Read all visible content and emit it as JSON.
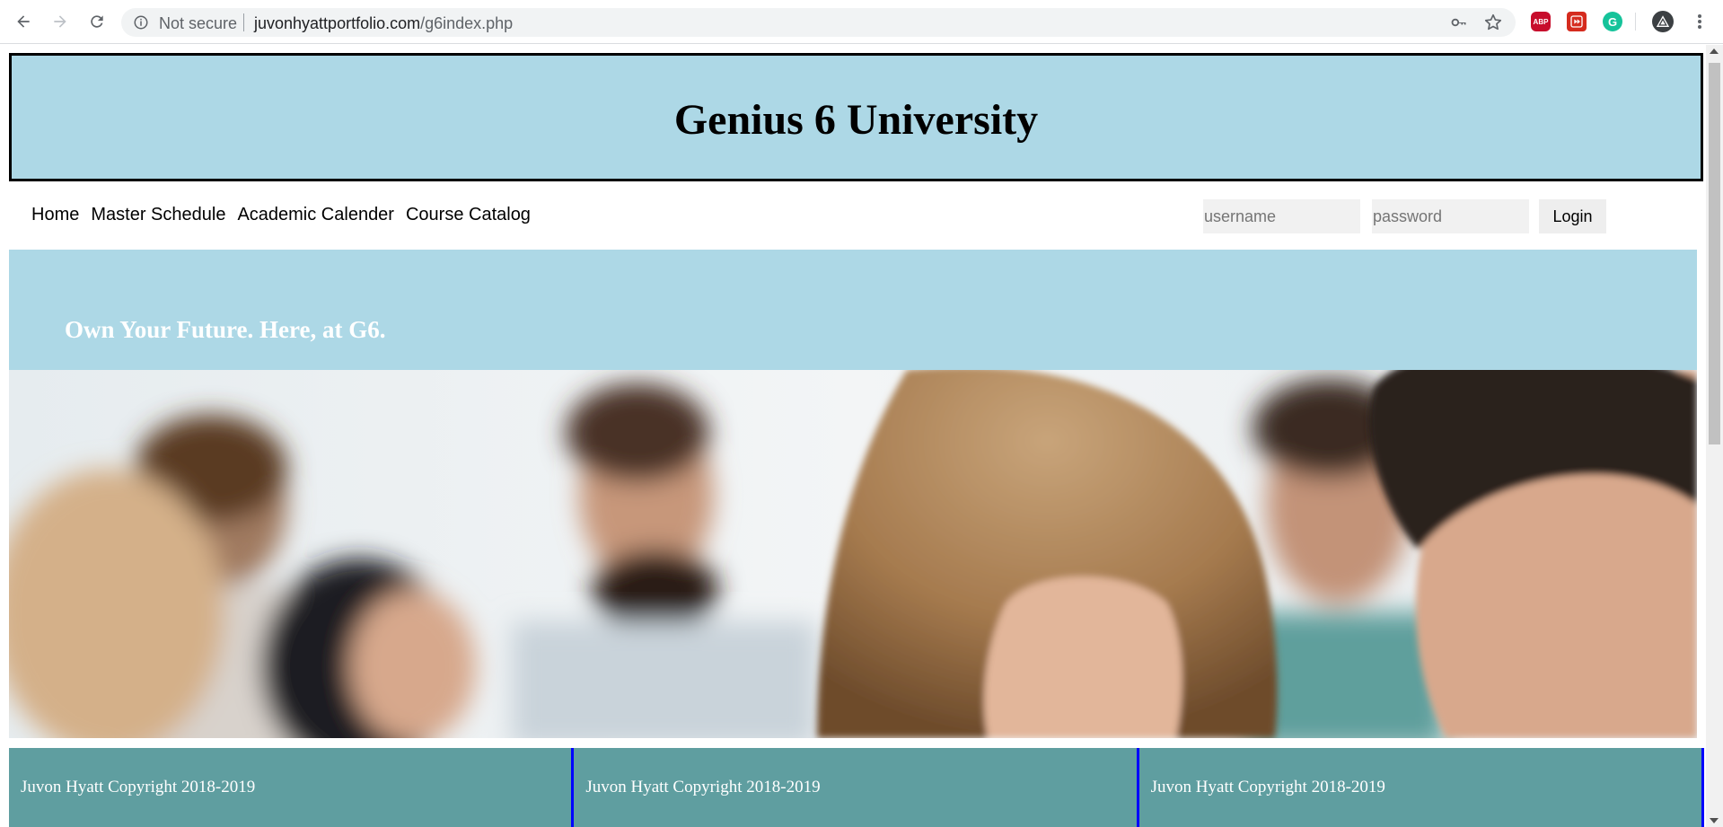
{
  "browser": {
    "security_label": "Not secure",
    "url_host": "juvonhyattportfolio.com",
    "url_path": "/g6index.php",
    "extensions": {
      "abp_label": "ABP",
      "grammarly_label": "G"
    },
    "icons": [
      "back-icon",
      "forward-icon",
      "reload-icon",
      "info-icon",
      "key-icon",
      "star-icon",
      "adblock-icon",
      "media-extension-icon",
      "grammarly-icon",
      "profile-avatar-icon",
      "menu-dots-icon"
    ]
  },
  "site": {
    "title": "Genius 6 University",
    "nav": [
      "Home",
      "Master Schedule",
      "Academic Calender",
      "Course Catalog"
    ],
    "login": {
      "username_placeholder": "username",
      "password_placeholder": "password",
      "button_label": "Login"
    },
    "tagline": "Own Your Future. Here, at G6.",
    "footer": [
      "Juvon Hyatt Copyright 2018-2019",
      "Juvon Hyatt Copyright 2018-2019",
      "Juvon Hyatt Copyright 2018-2019"
    ]
  },
  "colors": {
    "header_bg": "#add8e6",
    "footer_bg": "#5f9ea0",
    "footer_divider": "#0000ff",
    "tagline_text": "#ffffff"
  }
}
